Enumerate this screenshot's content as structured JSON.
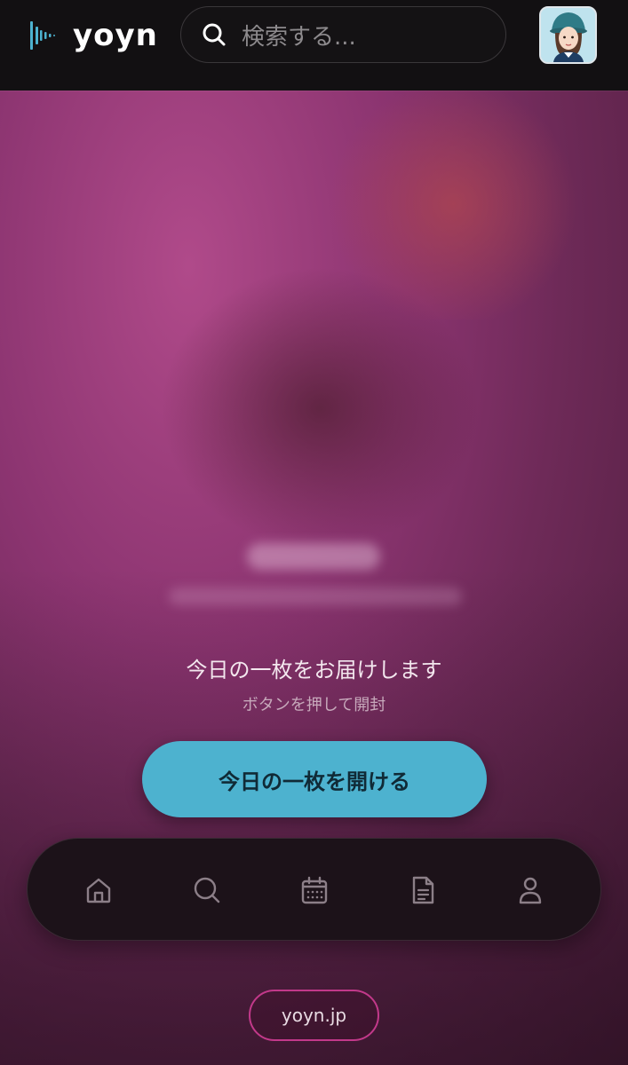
{
  "header": {
    "brand": "yoyn",
    "search_placeholder": "検索する..."
  },
  "main": {
    "title": "今日の一枚をお届けします",
    "subtitle": "ボタンを押して開封",
    "open_button_label": "今日の一枚を開ける"
  },
  "nav": {
    "items": [
      {
        "icon": "home-icon"
      },
      {
        "icon": "search-icon"
      },
      {
        "icon": "calendar-icon"
      },
      {
        "icon": "document-icon"
      },
      {
        "icon": "profile-icon"
      }
    ]
  },
  "footer": {
    "link": "yoyn.jp"
  },
  "colors": {
    "accent": "#4db2cf",
    "footer_border": "#c2398a",
    "header_bg": "#121012"
  }
}
